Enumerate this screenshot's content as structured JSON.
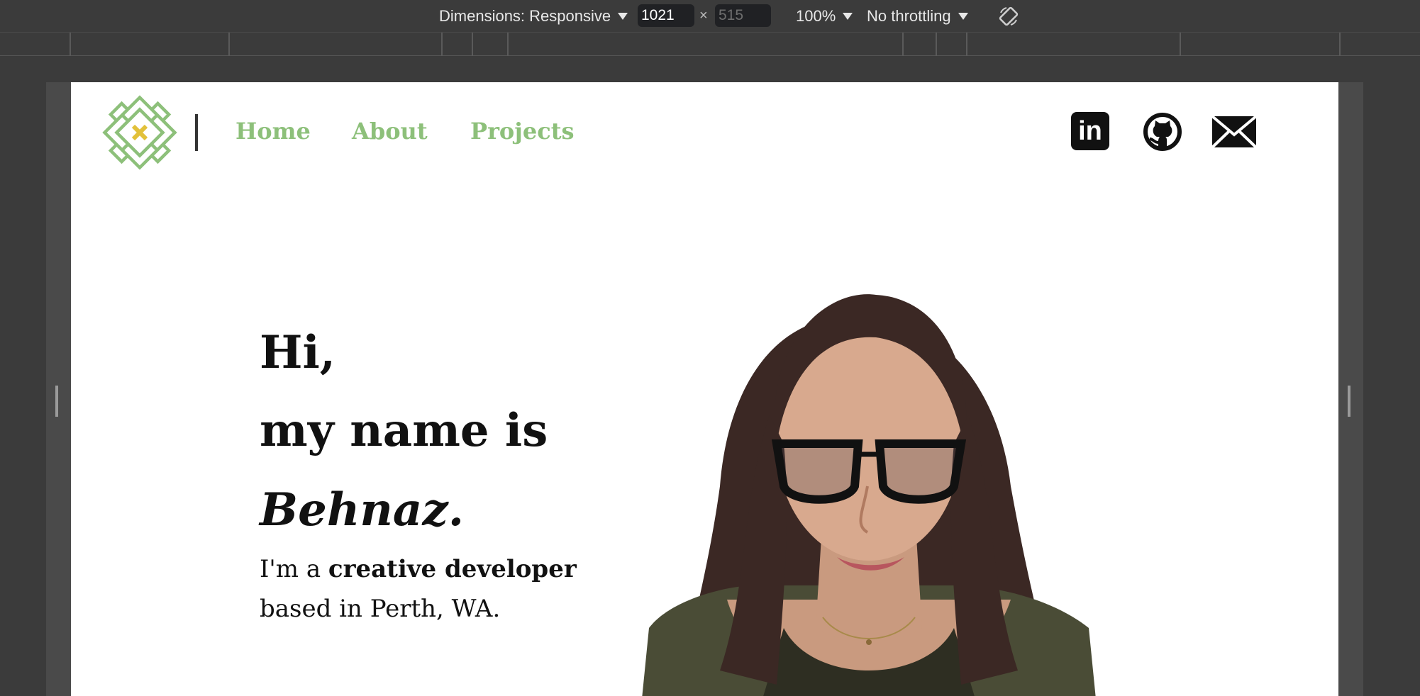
{
  "devtools": {
    "dimensions_label": "Dimensions: Responsive",
    "width_value": "1021",
    "times_symbol": "×",
    "height_placeholder": "515",
    "zoom_label": "100%",
    "throttle_label": "No throttling",
    "rotate_icon": "rotate-icon"
  },
  "nav": {
    "logo_icon": "knot-logo-icon",
    "items": [
      {
        "label": "Home"
      },
      {
        "label": "About"
      },
      {
        "label": "Projects"
      }
    ]
  },
  "social": {
    "linkedin_text": "in",
    "icons": [
      "linkedin-icon",
      "github-icon",
      "mail-icon"
    ]
  },
  "hero": {
    "line1": "Hi,",
    "line2": "my name is",
    "name": "Behnaz.",
    "sub_prefix": "I'm a ",
    "sub_bold": "creative developer",
    "sub_line2": "based in Perth, WA."
  },
  "colors": {
    "accent_green": "#8dc07a",
    "logo_center": "#e2c13a",
    "text": "#111111",
    "devtools_bg": "#3b3b3b"
  }
}
